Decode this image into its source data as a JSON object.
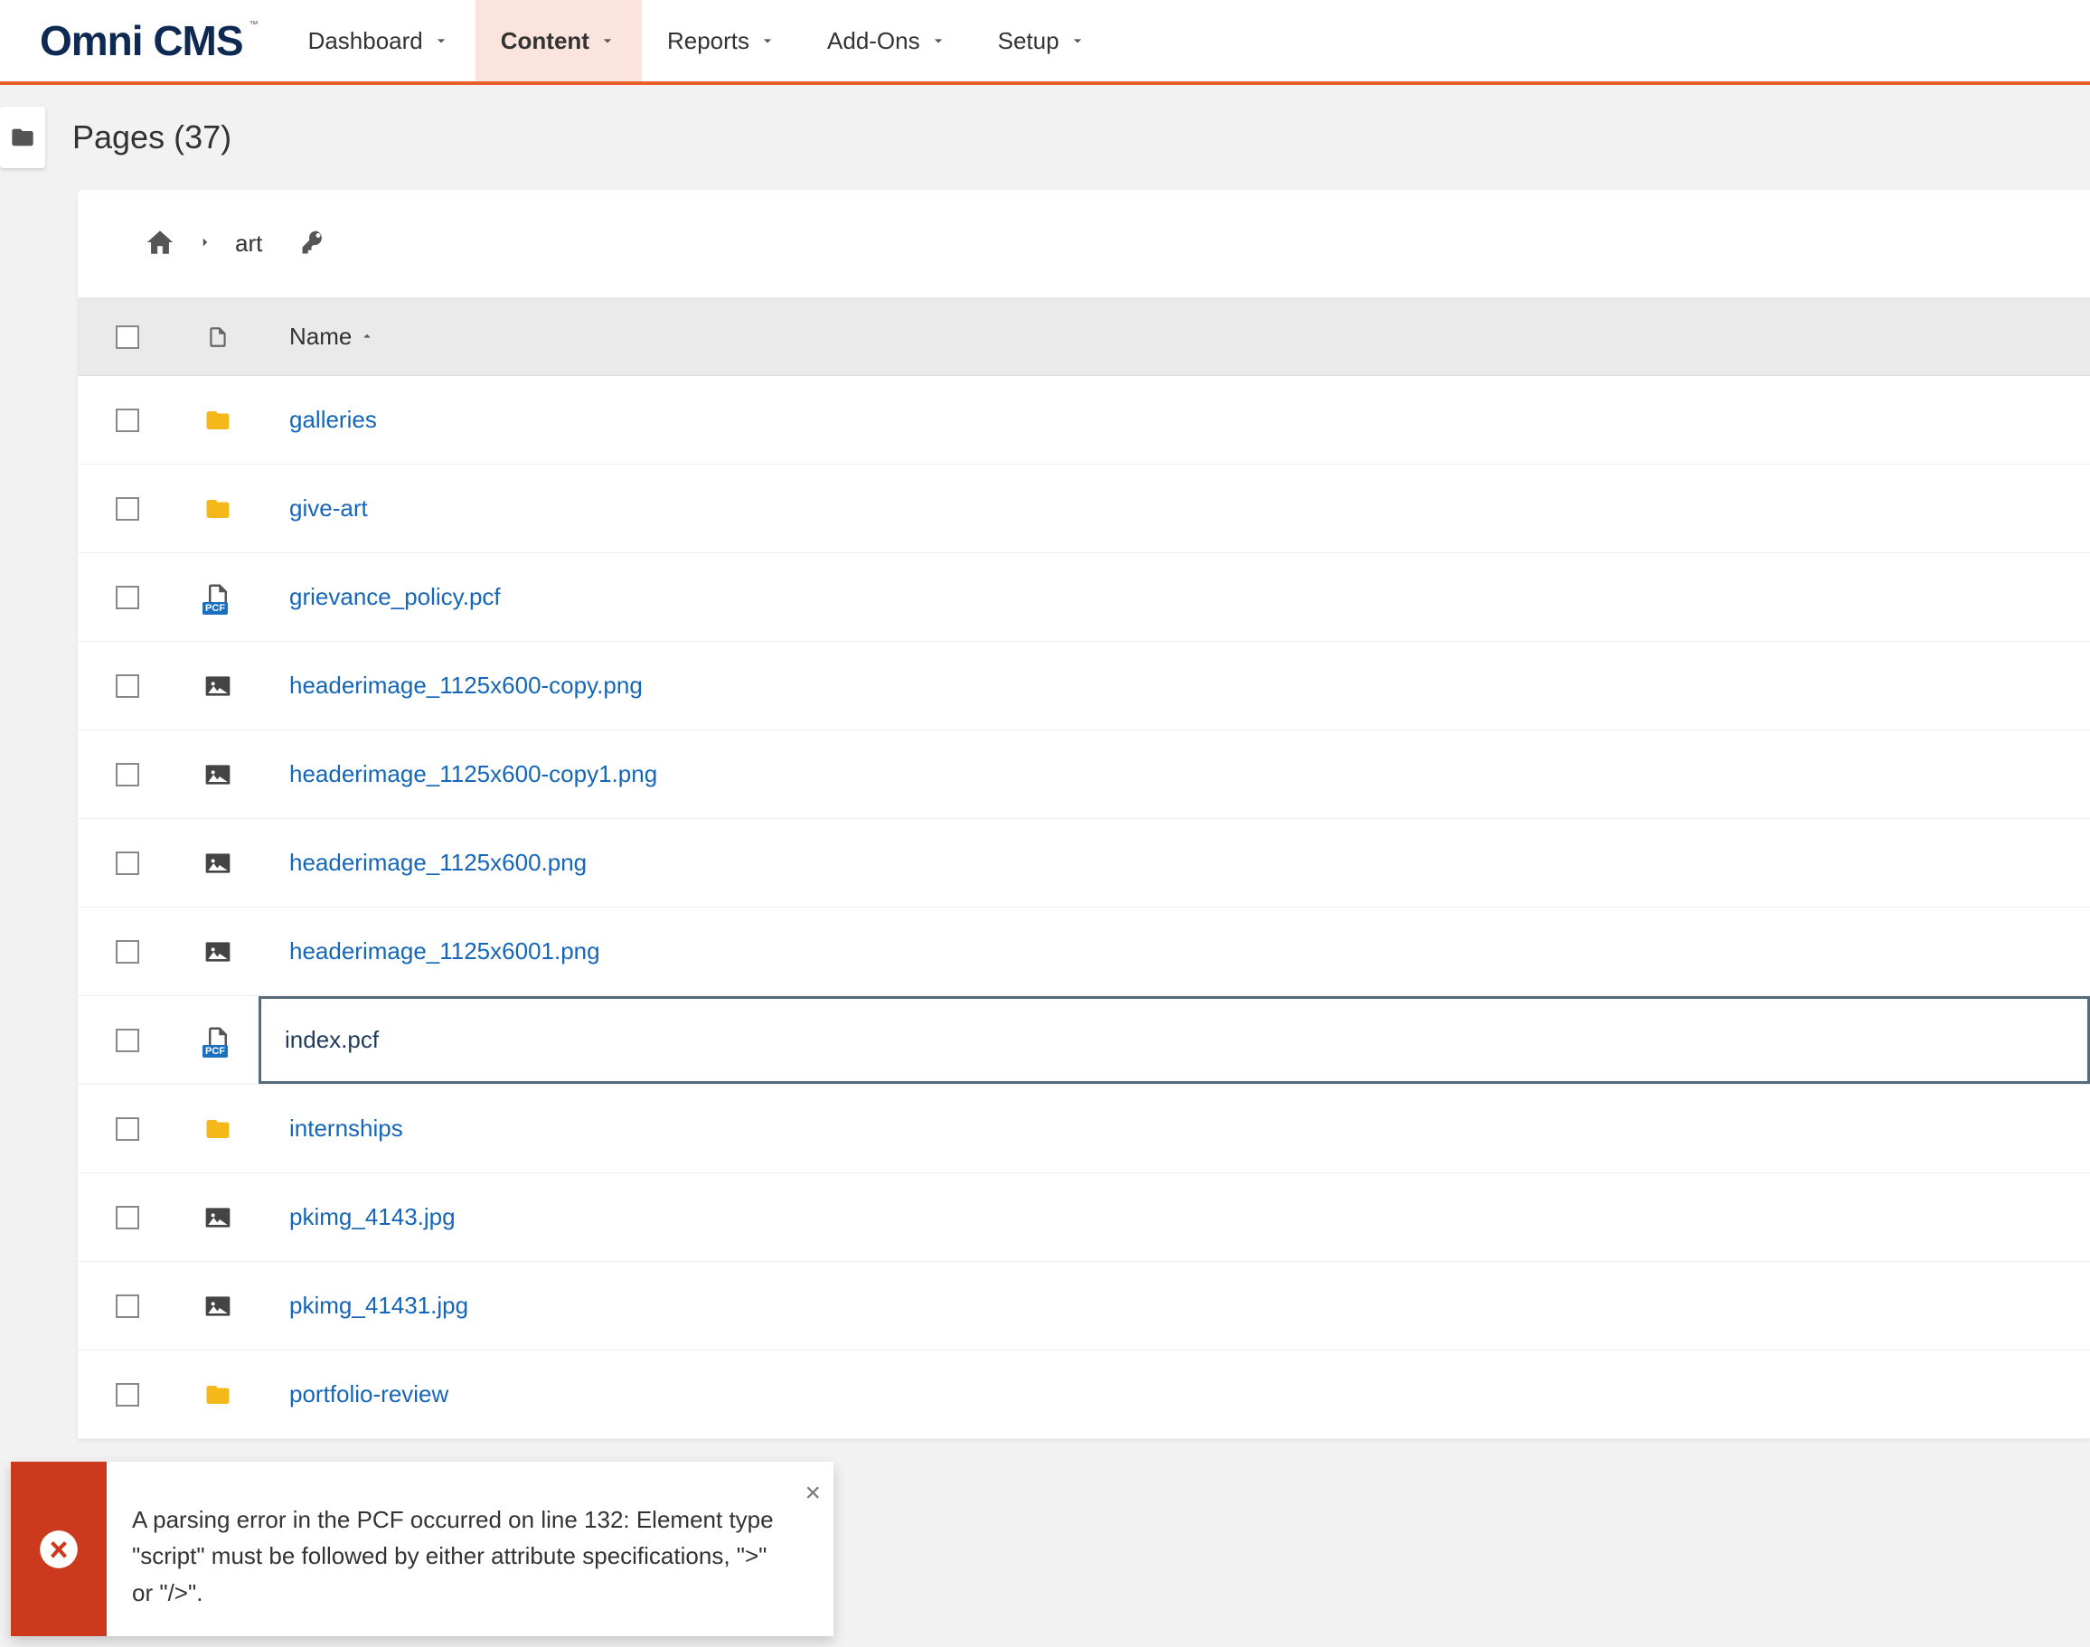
{
  "logo": "Omni CMS",
  "nav": {
    "items": [
      {
        "label": "Dashboard",
        "active": false
      },
      {
        "label": "Content",
        "active": true
      },
      {
        "label": "Reports",
        "active": false
      },
      {
        "label": "Add-Ons",
        "active": false
      },
      {
        "label": "Setup",
        "active": false
      }
    ]
  },
  "page": {
    "title": "Pages (37)"
  },
  "breadcrumb": {
    "path": [
      "art"
    ]
  },
  "table": {
    "columns": {
      "name": "Name"
    },
    "rows": [
      {
        "type": "folder",
        "name": "galleries"
      },
      {
        "type": "folder",
        "name": "give-art"
      },
      {
        "type": "pcf",
        "name": "grievance_policy.pcf"
      },
      {
        "type": "image",
        "name": "headerimage_1125x600-copy.png"
      },
      {
        "type": "image",
        "name": "headerimage_1125x600-copy1.png"
      },
      {
        "type": "image",
        "name": "headerimage_1125x600.png"
      },
      {
        "type": "image",
        "name": "headerimage_1125x6001.png"
      },
      {
        "type": "pcf",
        "name": "index.pcf",
        "renaming": true
      },
      {
        "type": "folder",
        "name": "internships"
      },
      {
        "type": "image",
        "name": "pkimg_4143.jpg"
      },
      {
        "type": "image",
        "name": "pkimg_41431.jpg"
      },
      {
        "type": "folder",
        "name": "portfolio-review"
      }
    ]
  },
  "toast": {
    "message": "A parsing error in the PCF occurred on line 132: Element type \"script\" must be followed by either attribute specifications, \">\" or \"/>\"."
  }
}
